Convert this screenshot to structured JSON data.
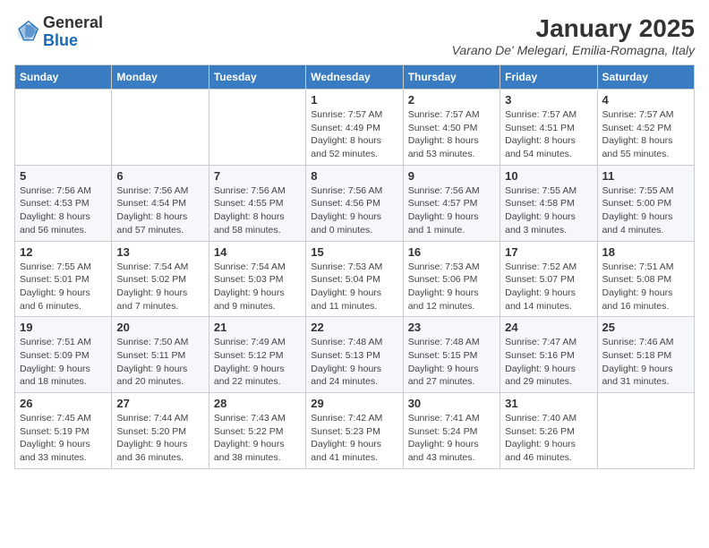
{
  "header": {
    "logo_general": "General",
    "logo_blue": "Blue",
    "title": "January 2025",
    "location": "Varano De' Melegari, Emilia-Romagna, Italy"
  },
  "columns": [
    "Sunday",
    "Monday",
    "Tuesday",
    "Wednesday",
    "Thursday",
    "Friday",
    "Saturday"
  ],
  "weeks": [
    [
      {
        "day": "",
        "info": ""
      },
      {
        "day": "",
        "info": ""
      },
      {
        "day": "",
        "info": ""
      },
      {
        "day": "1",
        "info": "Sunrise: 7:57 AM\nSunset: 4:49 PM\nDaylight: 8 hours\nand 52 minutes."
      },
      {
        "day": "2",
        "info": "Sunrise: 7:57 AM\nSunset: 4:50 PM\nDaylight: 8 hours\nand 53 minutes."
      },
      {
        "day": "3",
        "info": "Sunrise: 7:57 AM\nSunset: 4:51 PM\nDaylight: 8 hours\nand 54 minutes."
      },
      {
        "day": "4",
        "info": "Sunrise: 7:57 AM\nSunset: 4:52 PM\nDaylight: 8 hours\nand 55 minutes."
      }
    ],
    [
      {
        "day": "5",
        "info": "Sunrise: 7:56 AM\nSunset: 4:53 PM\nDaylight: 8 hours\nand 56 minutes."
      },
      {
        "day": "6",
        "info": "Sunrise: 7:56 AM\nSunset: 4:54 PM\nDaylight: 8 hours\nand 57 minutes."
      },
      {
        "day": "7",
        "info": "Sunrise: 7:56 AM\nSunset: 4:55 PM\nDaylight: 8 hours\nand 58 minutes."
      },
      {
        "day": "8",
        "info": "Sunrise: 7:56 AM\nSunset: 4:56 PM\nDaylight: 9 hours\nand 0 minutes."
      },
      {
        "day": "9",
        "info": "Sunrise: 7:56 AM\nSunset: 4:57 PM\nDaylight: 9 hours\nand 1 minute."
      },
      {
        "day": "10",
        "info": "Sunrise: 7:55 AM\nSunset: 4:58 PM\nDaylight: 9 hours\nand 3 minutes."
      },
      {
        "day": "11",
        "info": "Sunrise: 7:55 AM\nSunset: 5:00 PM\nDaylight: 9 hours\nand 4 minutes."
      }
    ],
    [
      {
        "day": "12",
        "info": "Sunrise: 7:55 AM\nSunset: 5:01 PM\nDaylight: 9 hours\nand 6 minutes."
      },
      {
        "day": "13",
        "info": "Sunrise: 7:54 AM\nSunset: 5:02 PM\nDaylight: 9 hours\nand 7 minutes."
      },
      {
        "day": "14",
        "info": "Sunrise: 7:54 AM\nSunset: 5:03 PM\nDaylight: 9 hours\nand 9 minutes."
      },
      {
        "day": "15",
        "info": "Sunrise: 7:53 AM\nSunset: 5:04 PM\nDaylight: 9 hours\nand 11 minutes."
      },
      {
        "day": "16",
        "info": "Sunrise: 7:53 AM\nSunset: 5:06 PM\nDaylight: 9 hours\nand 12 minutes."
      },
      {
        "day": "17",
        "info": "Sunrise: 7:52 AM\nSunset: 5:07 PM\nDaylight: 9 hours\nand 14 minutes."
      },
      {
        "day": "18",
        "info": "Sunrise: 7:51 AM\nSunset: 5:08 PM\nDaylight: 9 hours\nand 16 minutes."
      }
    ],
    [
      {
        "day": "19",
        "info": "Sunrise: 7:51 AM\nSunset: 5:09 PM\nDaylight: 9 hours\nand 18 minutes."
      },
      {
        "day": "20",
        "info": "Sunrise: 7:50 AM\nSunset: 5:11 PM\nDaylight: 9 hours\nand 20 minutes."
      },
      {
        "day": "21",
        "info": "Sunrise: 7:49 AM\nSunset: 5:12 PM\nDaylight: 9 hours\nand 22 minutes."
      },
      {
        "day": "22",
        "info": "Sunrise: 7:48 AM\nSunset: 5:13 PM\nDaylight: 9 hours\nand 24 minutes."
      },
      {
        "day": "23",
        "info": "Sunrise: 7:48 AM\nSunset: 5:15 PM\nDaylight: 9 hours\nand 27 minutes."
      },
      {
        "day": "24",
        "info": "Sunrise: 7:47 AM\nSunset: 5:16 PM\nDaylight: 9 hours\nand 29 minutes."
      },
      {
        "day": "25",
        "info": "Sunrise: 7:46 AM\nSunset: 5:18 PM\nDaylight: 9 hours\nand 31 minutes."
      }
    ],
    [
      {
        "day": "26",
        "info": "Sunrise: 7:45 AM\nSunset: 5:19 PM\nDaylight: 9 hours\nand 33 minutes."
      },
      {
        "day": "27",
        "info": "Sunrise: 7:44 AM\nSunset: 5:20 PM\nDaylight: 9 hours\nand 36 minutes."
      },
      {
        "day": "28",
        "info": "Sunrise: 7:43 AM\nSunset: 5:22 PM\nDaylight: 9 hours\nand 38 minutes."
      },
      {
        "day": "29",
        "info": "Sunrise: 7:42 AM\nSunset: 5:23 PM\nDaylight: 9 hours\nand 41 minutes."
      },
      {
        "day": "30",
        "info": "Sunrise: 7:41 AM\nSunset: 5:24 PM\nDaylight: 9 hours\nand 43 minutes."
      },
      {
        "day": "31",
        "info": "Sunrise: 7:40 AM\nSunset: 5:26 PM\nDaylight: 9 hours\nand 46 minutes."
      },
      {
        "day": "",
        "info": ""
      }
    ]
  ]
}
